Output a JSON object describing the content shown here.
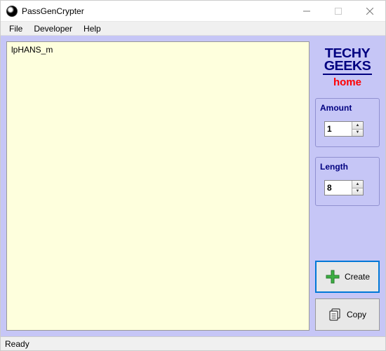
{
  "window": {
    "title": "PassGenCrypter"
  },
  "menu": {
    "file": "File",
    "developer": "Developer",
    "help": "Help"
  },
  "output": {
    "text": "lpHANS_m"
  },
  "brand": {
    "line1": "TECHY",
    "line2": "GEEKS",
    "line3": "home"
  },
  "fields": {
    "amount": {
      "label": "Amount",
      "value": "1"
    },
    "length": {
      "label": "Length",
      "value": "8"
    }
  },
  "buttons": {
    "create": "Create",
    "copy": "Copy"
  },
  "status": {
    "text": "Ready"
  }
}
